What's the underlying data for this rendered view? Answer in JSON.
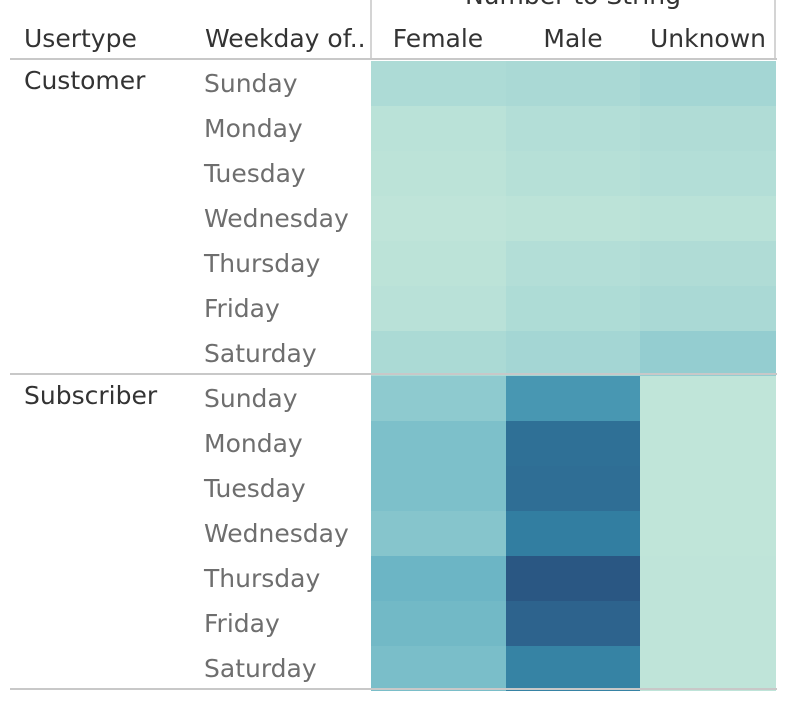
{
  "chart_data": {
    "type": "heatmap",
    "title": "",
    "column_group_title": "Number to String",
    "row_headers": [
      "Usertype",
      "Weekday of.."
    ],
    "columns": [
      "Female",
      "Male",
      "Unknown"
    ],
    "color_scale": {
      "low": "#c2e6d9",
      "high": "#2a5783"
    },
    "groups": [
      {
        "usertype": "Customer",
        "rows": [
          {
            "weekday": "Sunday",
            "values": [
              0.14,
              0.16,
              0.2
            ]
          },
          {
            "weekday": "Monday",
            "values": [
              0.05,
              0.1,
              0.12
            ]
          },
          {
            "weekday": "Tuesday",
            "values": [
              0.04,
              0.08,
              0.1
            ]
          },
          {
            "weekday": "Wednesday",
            "values": [
              0.02,
              0.04,
              0.05
            ]
          },
          {
            "weekday": "Thursday",
            "values": [
              0.04,
              0.1,
              0.12
            ]
          },
          {
            "weekday": "Friday",
            "values": [
              0.06,
              0.13,
              0.16
            ]
          },
          {
            "weekday": "Saturday",
            "values": [
              0.15,
              0.2,
              0.28
            ]
          }
        ]
      },
      {
        "usertype": "Subscriber",
        "rows": [
          {
            "weekday": "Sunday",
            "values": [
              0.3,
              0.6,
              0.01
            ]
          },
          {
            "weekday": "Monday",
            "values": [
              0.36,
              0.84,
              0.01
            ]
          },
          {
            "weekday": "Tuesday",
            "values": [
              0.36,
              0.85,
              0.01
            ]
          },
          {
            "weekday": "Wednesday",
            "values": [
              0.33,
              0.75,
              0.01
            ]
          },
          {
            "weekday": "Thursday",
            "values": [
              0.42,
              1.0,
              0.02
            ]
          },
          {
            "weekday": "Friday",
            "values": [
              0.4,
              0.92,
              0.02
            ]
          },
          {
            "weekday": "Saturday",
            "values": [
              0.37,
              0.72,
              0.02
            ]
          }
        ]
      }
    ]
  }
}
